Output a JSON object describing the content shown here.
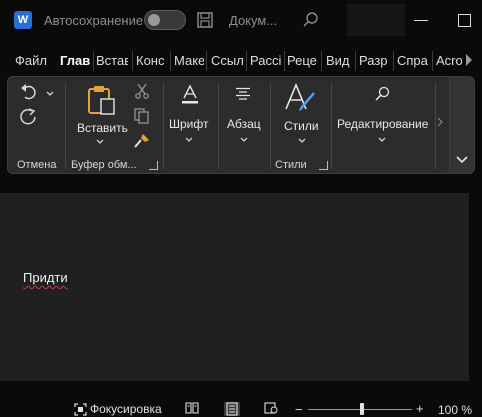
{
  "titlebar": {
    "app_letter": "W",
    "autosave_label": "Автосохранение",
    "doc_title": "Докум..."
  },
  "tabs": [
    "Файл",
    "Глав",
    "Встав",
    "Конс",
    "Маке",
    "Ссыл",
    "Рассі",
    "Реце",
    "Вид",
    "Разр",
    "Спра",
    "Acro"
  ],
  "active_tab": "Глав",
  "ribbon": {
    "undo_group_label": "Отмена",
    "clipboard": {
      "paste_label": "Вставить",
      "group_label": "Буфер обм..."
    },
    "font": {
      "label": "Шрифт"
    },
    "paragraph": {
      "label": "Абзац"
    },
    "styles": {
      "label": "Стили",
      "group_label": "Стили"
    },
    "editing": {
      "label": "Редактирование"
    }
  },
  "document": {
    "text": "Придти"
  },
  "statusbar": {
    "focus_label": "Фокусировка",
    "zoom_minus": "−",
    "zoom_plus": "+",
    "zoom_level": "100 %",
    "zoom_percent": 100
  },
  "colors": {
    "accent": "#7aa9ff",
    "word_brand": "#2b6fd6",
    "spell_error": "#d03a3a",
    "page_bg": "#202020",
    "ribbon_bg": "#2c2c2c"
  },
  "icons": [
    "word-logo-icon",
    "save-icon",
    "search-icon",
    "undo-icon",
    "redo-icon",
    "paste-icon",
    "cut-icon",
    "copy-icon",
    "format-painter-icon",
    "font-color-icon",
    "paragraph-icon",
    "styles-icon",
    "find-icon",
    "collapse-ribbon-icon",
    "focus-icon",
    "read-mode-icon",
    "print-layout-icon",
    "web-layout-icon"
  ]
}
